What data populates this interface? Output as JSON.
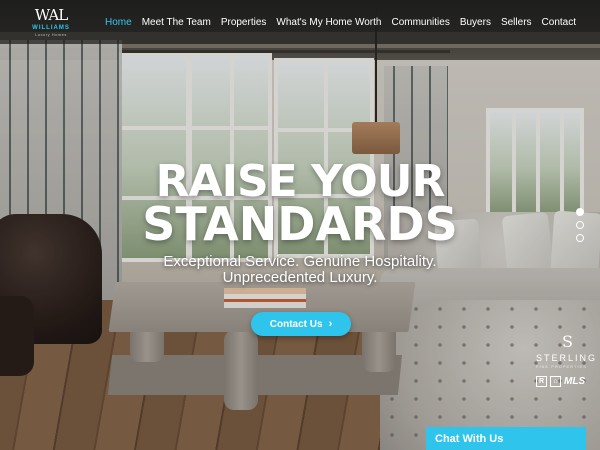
{
  "brand": {
    "mark": "WAL",
    "name": "WILLIAMS",
    "tagline": "Luxury Homes"
  },
  "nav": {
    "items": [
      {
        "label": "Home",
        "active": true
      },
      {
        "label": "Meet The Team",
        "active": false
      },
      {
        "label": "Properties",
        "active": false
      },
      {
        "label": "What's My Home Worth",
        "active": false
      },
      {
        "label": "Communities",
        "active": false
      },
      {
        "label": "Buyers",
        "active": false
      },
      {
        "label": "Sellers",
        "active": false
      },
      {
        "label": "Contact",
        "active": false
      }
    ]
  },
  "hero": {
    "headline_1": "RAISE YOUR",
    "headline_2": "STANDARDS",
    "subline_1": "Exceptional Service. Genuine Hospitality.",
    "subline_2": "Unprecedented Luxury.",
    "cta_label": "Contact Us",
    "cta_icon": "chevron-right-icon",
    "slider": {
      "count": 3,
      "active_index": 0
    }
  },
  "affiliation": {
    "mark": "S",
    "name": "STERLING",
    "tagline": "FINE PROPERTIES",
    "badge_1": "R",
    "badge_2": "⌂",
    "badge_3": "MLS"
  },
  "chat": {
    "label": "Chat With Us"
  },
  "colors": {
    "accent": "#2ec4ec",
    "nav_bg": "#1c1c1c",
    "text": "#ffffff"
  }
}
